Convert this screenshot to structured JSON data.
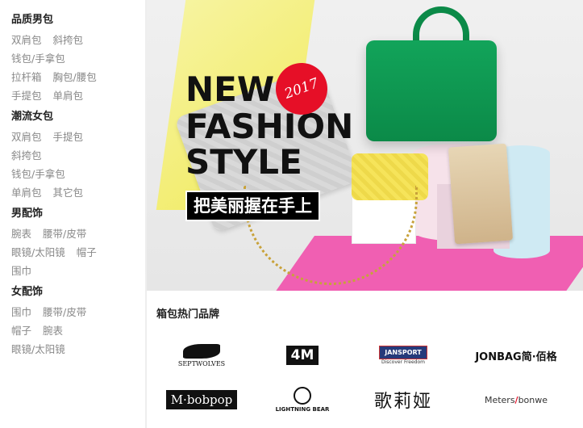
{
  "menu": {
    "categories": [
      {
        "title": "品质男包",
        "rows": [
          [
            "双肩包",
            "斜挎包"
          ],
          [
            "钱包/手拿包"
          ],
          [
            "拉杆箱",
            "胸包/腰包"
          ],
          [
            "手提包",
            "单肩包"
          ]
        ]
      },
      {
        "title": "潮流女包",
        "rows": [
          [
            "双肩包",
            "手提包"
          ],
          [
            "斜挎包"
          ],
          [
            "钱包/手拿包"
          ],
          [
            "单肩包",
            "其它包"
          ]
        ]
      },
      {
        "title": "男配饰",
        "rows": [
          [
            "腕表",
            "腰带/皮带"
          ],
          [
            "眼镜/太阳镜",
            "帽子"
          ],
          [
            "围巾"
          ]
        ]
      },
      {
        "title": "女配饰",
        "rows": [
          [
            "围巾",
            "腰带/皮带"
          ],
          [
            "帽子",
            "腕表"
          ],
          [
            "眼镜/太阳镜"
          ]
        ]
      }
    ]
  },
  "banner": {
    "line1": "NEW",
    "line2": "FASHION",
    "line3": "STYLE",
    "year": "2017",
    "slogan": "把美丽握在手上"
  },
  "brands": {
    "title": "箱包热门品牌",
    "sept_text": "SEPTWOLVES",
    "m4": "4M",
    "jan_box": "JANSPORT",
    "jan_sub": "Discover Freedom",
    "jonbag": "JONBAG简·佰格",
    "mbb": "M·bobpop",
    "lb": "LIGHTNING BEAR",
    "gly": "歌莉娅",
    "mb_a": "Meters",
    "mb_slash": "/",
    "mb_b": "bonwe"
  },
  "colors": {
    "accent": "#e60f27",
    "green_bag": "#0b8a48",
    "pink_base": "#f05fb2"
  }
}
